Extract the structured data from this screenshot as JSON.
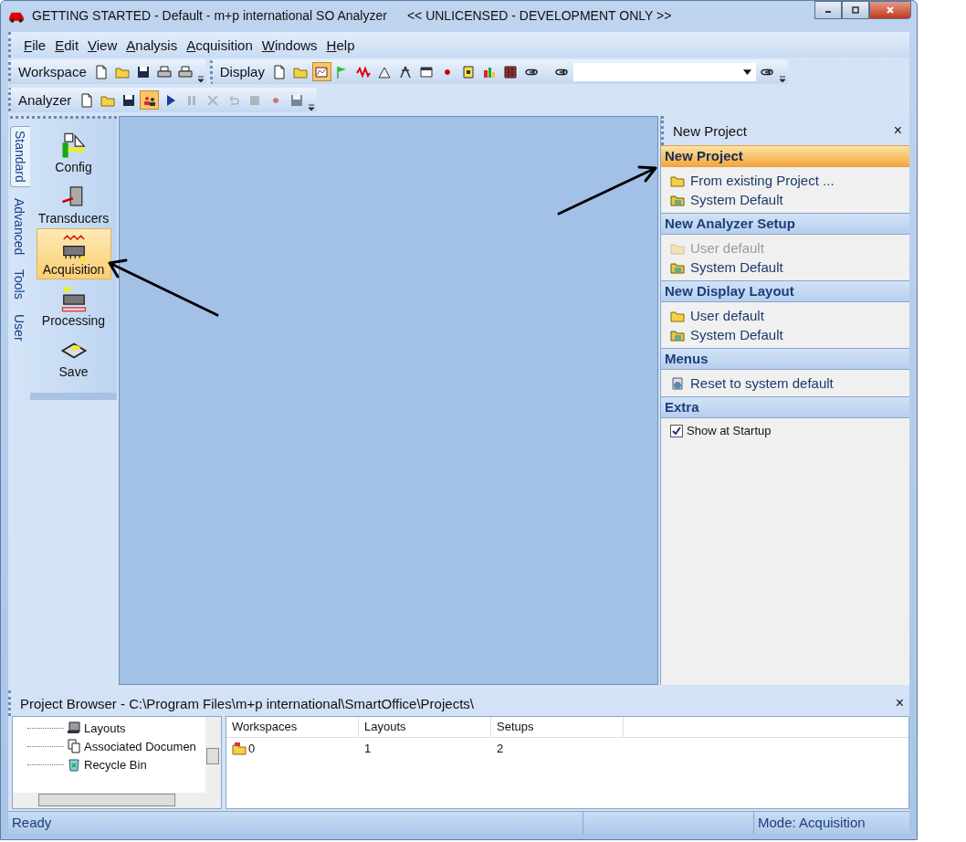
{
  "window": {
    "title": "GETTING STARTED - Default - m+p international SO Analyzer",
    "notice": "<< UNLICENSED - DEVELOPMENT ONLY >>"
  },
  "menu": [
    "File",
    "Edit",
    "View",
    "Analysis",
    "Acquisition",
    "Windows",
    "Help"
  ],
  "toolbar_rows": [
    {
      "toolbars": [
        {
          "label": "Workspace",
          "buttons": [
            {
              "kind": "new",
              "selected": false,
              "disabled": false
            },
            {
              "kind": "open",
              "selected": false,
              "disabled": false
            },
            {
              "kind": "save",
              "selected": false,
              "disabled": false
            },
            {
              "kind": "print",
              "selected": false,
              "disabled": false
            },
            {
              "kind": "print",
              "selected": false,
              "disabled": false
            }
          ]
        },
        {
          "label": "Display",
          "buttons": [
            {
              "kind": "new",
              "selected": false,
              "disabled": false
            },
            {
              "kind": "open",
              "selected": false,
              "disabled": false
            },
            {
              "kind": "plot",
              "selected": true,
              "disabled": false
            },
            {
              "kind": "flag",
              "selected": false,
              "disabled": false
            },
            {
              "kind": "wave",
              "selected": false,
              "disabled": false
            },
            {
              "kind": "triangle",
              "selected": false,
              "disabled": false
            },
            {
              "kind": "tool",
              "selected": false,
              "disabled": false
            },
            {
              "kind": "window",
              "selected": false,
              "disabled": false
            },
            {
              "kind": "dot",
              "selected": false,
              "disabled": false
            },
            {
              "kind": "note",
              "selected": false,
              "disabled": false
            },
            {
              "kind": "bars",
              "selected": false,
              "disabled": false
            },
            {
              "kind": "grid",
              "selected": false,
              "disabled": false
            },
            {
              "kind": "link",
              "selected": false,
              "disabled": false
            },
            {
              "kind": "sep"
            },
            {
              "kind": "link",
              "selected": false,
              "disabled": false
            },
            {
              "kind": "combo"
            },
            {
              "kind": "link",
              "selected": false,
              "disabled": false
            }
          ]
        }
      ]
    },
    {
      "toolbars": [
        {
          "label": "Analyzer",
          "buttons": [
            {
              "kind": "new",
              "selected": false,
              "disabled": false
            },
            {
              "kind": "open",
              "selected": false,
              "disabled": false
            },
            {
              "kind": "save",
              "selected": false,
              "disabled": false
            },
            {
              "kind": "people",
              "selected": true,
              "disabled": false
            },
            {
              "kind": "play",
              "selected": false,
              "disabled": false
            },
            {
              "kind": "pause",
              "selected": false,
              "disabled": true
            },
            {
              "kind": "cross",
              "selected": false,
              "disabled": true
            },
            {
              "kind": "undo",
              "selected": false,
              "disabled": true
            },
            {
              "kind": "stop",
              "selected": false,
              "disabled": true
            },
            {
              "kind": "dot",
              "selected": false,
              "disabled": true
            },
            {
              "kind": "save",
              "selected": false,
              "disabled": true
            }
          ]
        }
      ]
    }
  ],
  "sidebar": {
    "tabs": [
      {
        "label": "Standard",
        "selected": true
      },
      {
        "label": "Advanced",
        "selected": false
      },
      {
        "label": "Tools",
        "selected": false
      },
      {
        "label": "User",
        "selected": false
      }
    ],
    "items": [
      {
        "label": "Config",
        "kind": "config",
        "selected": false
      },
      {
        "label": "Transducers",
        "kind": "transducer",
        "selected": false
      },
      {
        "label": "Acquisition",
        "kind": "chip",
        "selected": true
      },
      {
        "label": "Processing",
        "kind": "chip2",
        "selected": false
      },
      {
        "label": "Save",
        "kind": "disk",
        "selected": false
      }
    ]
  },
  "task_pane": {
    "title": "New Project",
    "close": "×",
    "sections": [
      {
        "title": "New Project",
        "highlighted": true,
        "items": [
          {
            "kind": "open",
            "label": "From existing Project ...",
            "disabled": false
          },
          {
            "kind": "system",
            "label": "System Default",
            "disabled": false
          }
        ]
      },
      {
        "title": "New Analyzer Setup",
        "highlighted": false,
        "items": [
          {
            "kind": "open",
            "label": "User default",
            "disabled": true
          },
          {
            "kind": "system",
            "label": "System Default",
            "disabled": false
          }
        ]
      },
      {
        "title": "New Display Layout",
        "highlighted": false,
        "items": [
          {
            "kind": "open",
            "label": "User default",
            "disabled": false
          },
          {
            "kind": "system",
            "label": "System Default",
            "disabled": false
          }
        ]
      },
      {
        "title": "Menus",
        "highlighted": false,
        "items": [
          {
            "kind": "reset",
            "label": "Reset to system default",
            "disabled": false
          }
        ]
      },
      {
        "title": "Extra",
        "highlighted": false,
        "items": [
          {
            "kind": "checkbox",
            "label": "Show at Startup",
            "checked": true,
            "disabled": false
          }
        ]
      }
    ]
  },
  "project_browser": {
    "title": "Project Browser - C:\\Program Files\\m+p international\\SmartOffice\\Projects\\",
    "close": "×",
    "tree": [
      {
        "label": "Layouts",
        "kind": "layouts"
      },
      {
        "label": "Associated Documen",
        "kind": "documents"
      },
      {
        "label": "Recycle Bin",
        "kind": "bin"
      }
    ],
    "columns": [
      "Workspaces",
      "Layouts",
      "Setups"
    ],
    "rows": [
      [
        "0",
        "1",
        "2"
      ]
    ]
  },
  "status_bar": [
    "Ready",
    "Mode: Acquisition"
  ]
}
